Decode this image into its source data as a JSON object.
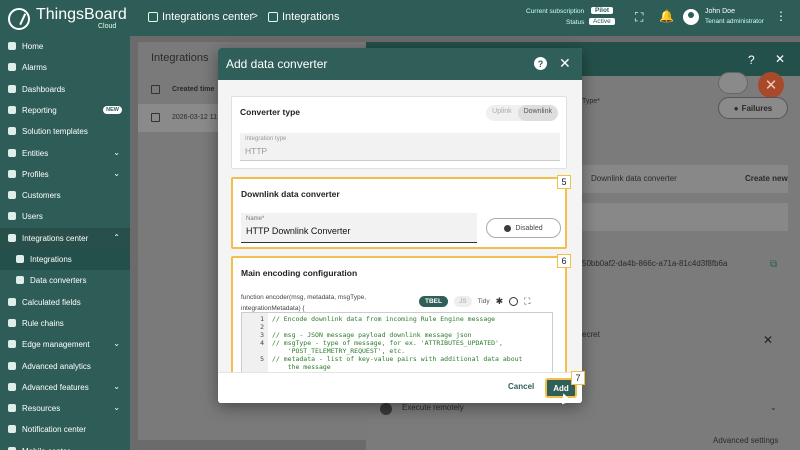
{
  "topbar": {
    "brand": "ThingsBoard",
    "brand_sub": "Cloud",
    "breadcrumb": [
      "Integrations center",
      "Integrations"
    ],
    "subscription_label": "Current subscription",
    "subscription_value": "Pilot",
    "status_label": "Status",
    "status_value": "Active",
    "user_name": "John Doe",
    "user_role": "Tenant administrator"
  },
  "sidebar": {
    "items": [
      {
        "label": "Home",
        "icon": "home-icon"
      },
      {
        "label": "Alarms",
        "icon": "bell-icon"
      },
      {
        "label": "Dashboards",
        "icon": "grid-icon"
      },
      {
        "label": "Reporting",
        "icon": "report-icon",
        "badge": "NEW"
      },
      {
        "label": "Solution templates",
        "icon": "template-icon"
      },
      {
        "label": "Entities",
        "icon": "entities-icon",
        "chevron": true
      },
      {
        "label": "Profiles",
        "icon": "profiles-icon",
        "chevron": true
      },
      {
        "label": "Customers",
        "icon": "customers-icon"
      },
      {
        "label": "Users",
        "icon": "users-icon"
      },
      {
        "label": "Integrations center",
        "icon": "integrations-icon",
        "chevron": true,
        "open": true
      },
      {
        "label": "Integrations",
        "icon": "plug-icon",
        "sub": true,
        "active": true
      },
      {
        "label": "Data converters",
        "icon": "converter-icon",
        "sub": true
      },
      {
        "label": "Calculated fields",
        "icon": "calc-icon"
      },
      {
        "label": "Rule chains",
        "icon": "rule-icon"
      },
      {
        "label": "Edge management",
        "icon": "edge-icon",
        "chevron": true
      },
      {
        "label": "Advanced analytics",
        "icon": "analytics-icon"
      },
      {
        "label": "Advanced features",
        "icon": "features-icon",
        "chevron": true
      },
      {
        "label": "Resources",
        "icon": "folder-icon",
        "chevron": true
      },
      {
        "label": "Notification center",
        "icon": "notification-icon"
      },
      {
        "label": "Mobile center",
        "icon": "mobile-icon"
      }
    ]
  },
  "background": {
    "page_title": "Integrations",
    "col_created": "Created time",
    "row_created": "2026-03-12 11:",
    "type_label": "Type*",
    "failures_label": "Failures",
    "downlink_field": "Downlink data converter",
    "create_new": "Create new",
    "uuid": "50bb0af2-da4b-866c-a71a-81c4d3f8fb6a",
    "secret_label": "ecret",
    "execute_remotely": "Execute remotely",
    "advanced_settings": "Advanced settings"
  },
  "dialog": {
    "title": "Add data converter",
    "converter_type": {
      "title": "Converter type",
      "uplink": "Uplink",
      "downlink": "Downlink",
      "integration_type_label": "Integration type",
      "integration_type_value": "HTTP"
    },
    "downlink": {
      "title": "Downlink data converter",
      "step": "5",
      "name_label": "Name*",
      "name_value": "HTTP Downlink Converter",
      "toggle_label": "Disabled"
    },
    "encoding": {
      "title": "Main encoding configuration",
      "step": "6",
      "signature": "function encoder(msg, metadata, msgType, integrationMetadata) {",
      "tbel": "TBEL",
      "js": "JS",
      "tidy": "Tidy",
      "code": [
        {
          "n": "1",
          "text": "// Encode downlink data from incoming Rule Engine message"
        },
        {
          "n": "2",
          "text": ""
        },
        {
          "n": "3",
          "text": "// msg - JSON message payload downlink message json"
        },
        {
          "n": "4",
          "text": "// msgType - type of message, for ex. 'ATTRIBUTES_UPDATED',"
        },
        {
          "n": "",
          "text": "    'POST_TELEMETRY_REQUEST', etc."
        },
        {
          "n": "5",
          "text": "// metadata - list of key-value pairs with additional data about"
        },
        {
          "n": "",
          "text": "    the message"
        },
        {
          "n": "6",
          "text": "// integrationMetadata - list of key-value pairs with additional"
        }
      ]
    },
    "cancel": "Cancel",
    "add": "Add",
    "add_step": "7"
  },
  "colors": {
    "primary": "#305f59",
    "highlight": "#f1c04a",
    "fab": "#a8492a"
  }
}
